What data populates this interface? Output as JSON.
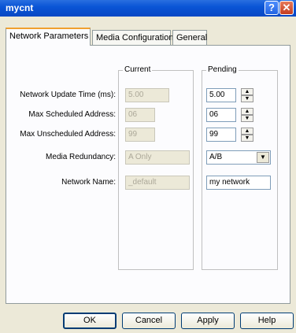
{
  "window": {
    "title": "mycnt",
    "help_glyph": "?",
    "close_glyph": "✕"
  },
  "tabs": [
    {
      "label": "Network Parameters",
      "active": true
    },
    {
      "label": "Media Configuration",
      "active": false
    },
    {
      "label": "General",
      "active": false
    }
  ],
  "groups": {
    "current": "Current",
    "pending": "Pending"
  },
  "rows": [
    {
      "label": "Network Update Time (ms):",
      "current": "5.00",
      "pending": "5.00"
    },
    {
      "label": "Max Scheduled Address:",
      "current": "06",
      "pending": "06"
    },
    {
      "label": "Max Unscheduled Address:",
      "current": "99",
      "pending": "99"
    },
    {
      "label": "Media Redundancy:",
      "current": "A Only",
      "pending": "A/B"
    },
    {
      "label": "Network Name:",
      "current": "_default",
      "pending": "my network"
    }
  ],
  "buttons": {
    "ok": "OK",
    "cancel": "Cancel",
    "apply": "Apply",
    "help": "Help"
  }
}
